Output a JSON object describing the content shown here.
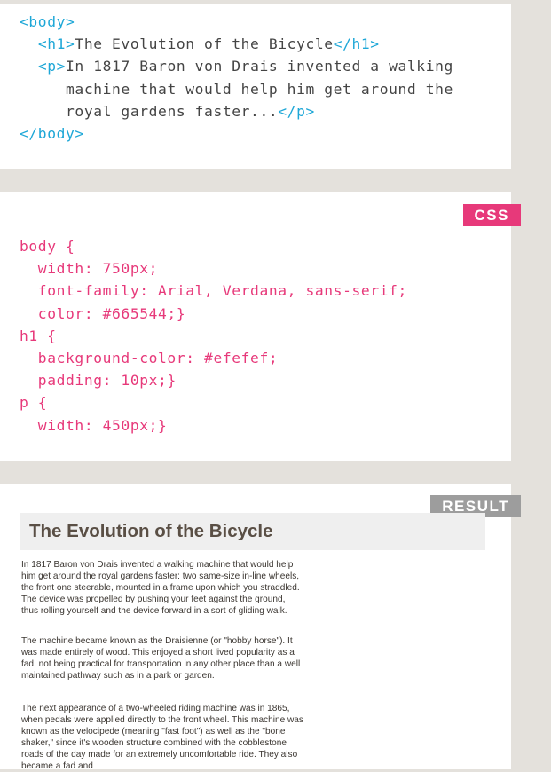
{
  "html_code": {
    "line1_tag": "<body>",
    "line2_open": "<h1>",
    "line2_text": "The Evolution of the Bicycle",
    "line2_close": "</h1>",
    "line3_open": "<p>",
    "line3_text": "In 1817 Baron von Drais invented a walking",
    "line4_text": "machine that would help him get around the",
    "line5_text": "royal gardens faster...",
    "line5_close": "</p>",
    "line6_tag": "</body>"
  },
  "css_tab": {
    "label": "CSS",
    "color": "#e7397a"
  },
  "css_code": [
    "body {",
    "  width: 750px;",
    "  font-family: Arial, Verdana, sans-serif;",
    "  color: #665544;}",
    "h1 {",
    "  background-color: #efefef;",
    "  padding: 10px;}",
    "p {",
    "  width: 450px;}"
  ],
  "result_tab": {
    "label": "RESULT",
    "color": "#9d9d9d"
  },
  "result": {
    "heading": "The Evolution of the Bicycle",
    "paragraphs": [
      "In 1817 Baron von Drais invented a walking machine that would help him get around the royal gardens faster: two same-size in-line wheels, the front one steerable, mounted in a frame upon which you straddled. The device was propelled by pushing your feet against the ground, thus rolling yourself and the device forward in a sort of gliding walk.",
      "The machine became known as the Draisienne (or \"hobby horse\"). It was made entirely of wood. This enjoyed a short lived popularity as a fad, not being practical for transportation in any other place than a well maintained pathway such as in a park or garden.",
      "The next appearance of a two-wheeled riding machine was in 1865, when pedals were applied directly to the front wheel. This machine was known as the velocipede (meaning \"fast foot\") as well as the \"bone shaker,\" since it's wooden structure combined with the cobblestone roads of the day made for an extremely uncomfortable ride. They also became a fad and"
    ]
  }
}
